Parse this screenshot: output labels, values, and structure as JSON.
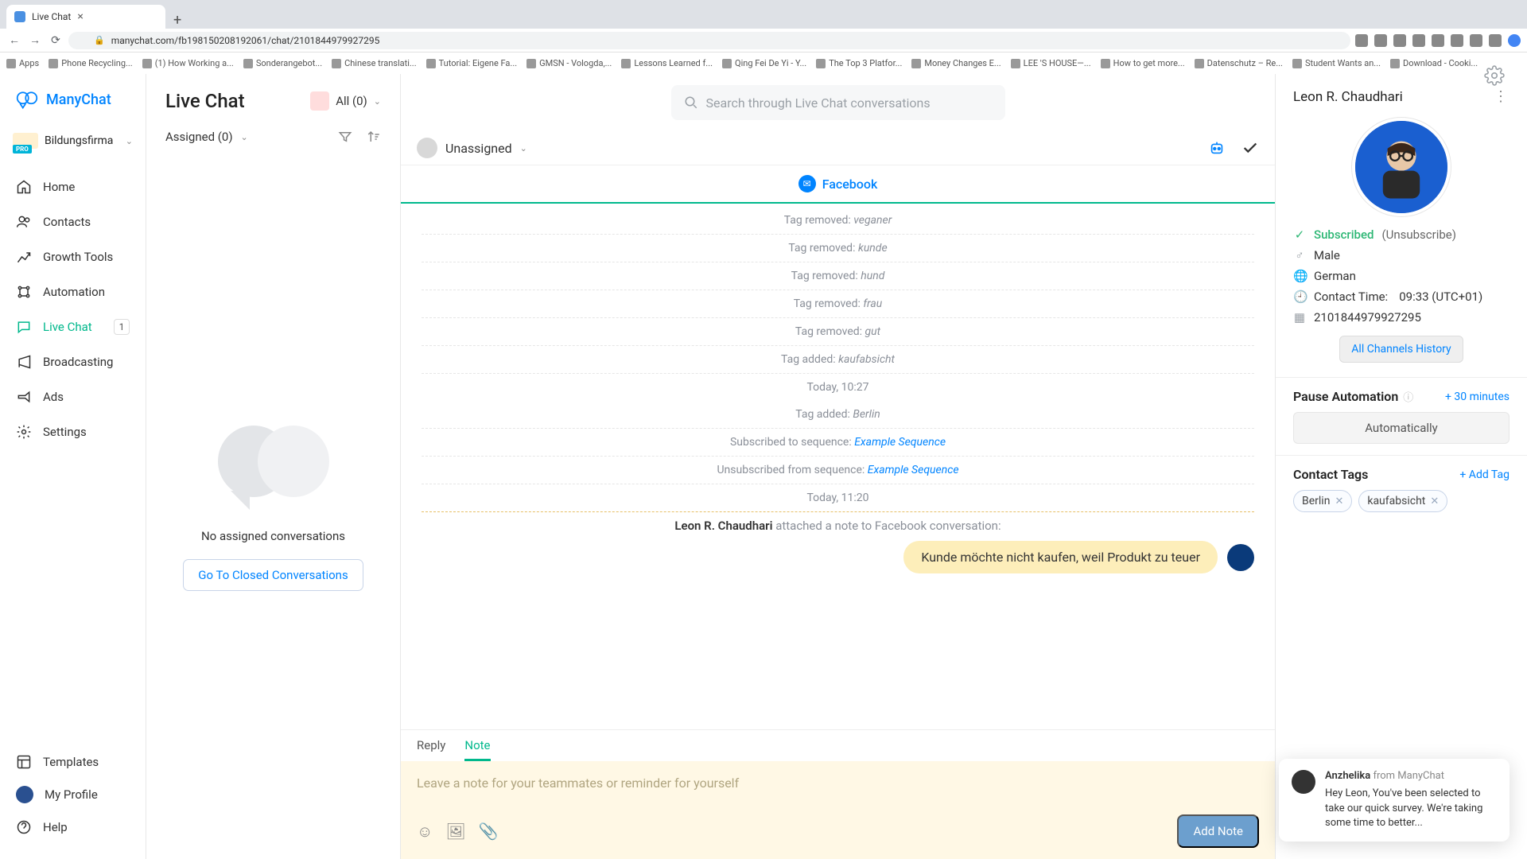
{
  "browser": {
    "tab_title": "Live Chat",
    "url": "manychat.com/fb198150208192061/chat/2101844979927295",
    "bookmarks": [
      "Apps",
      "Phone Recycling...",
      "(1) How Working a...",
      "Sonderangebot...",
      "Chinese translati...",
      "Tutorial: Eigene Fa...",
      "GMSN - Vologda,...",
      "Lessons Learned f...",
      "Qing Fei De Yi - Y...",
      "The Top 3 Platfor...",
      "Money Changes E...",
      "LEE 'S HOUSE—...",
      "How to get more...",
      "Datenschutz – Re...",
      "Student Wants an...",
      "Download - Cooki..."
    ]
  },
  "brand": {
    "name": "ManyChat"
  },
  "workspace": {
    "name": "Bildungsfirma",
    "badge": "PRO"
  },
  "nav": {
    "home": "Home",
    "contacts": "Contacts",
    "growth": "Growth Tools",
    "automation": "Automation",
    "livechat": "Live Chat",
    "livechat_badge": "1",
    "broadcasting": "Broadcasting",
    "ads": "Ads",
    "settings": "Settings",
    "templates": "Templates",
    "profile": "My Profile",
    "help": "Help"
  },
  "list": {
    "title": "Live Chat",
    "filter": "All (0)",
    "assigned": "Assigned (0)",
    "empty": "No assigned conversations",
    "closed_btn": "Go To Closed Conversations"
  },
  "search": {
    "placeholder": "Search through Live Chat conversations"
  },
  "chat": {
    "assignee": "Unassigned",
    "channel": "Facebook",
    "events": [
      {
        "prefix": "Tag removed: ",
        "em": "veganer"
      },
      {
        "prefix": "Tag removed: ",
        "em": "kunde"
      },
      {
        "prefix": "Tag removed: ",
        "em": "hund"
      },
      {
        "prefix": "Tag removed: ",
        "em": "frau"
      },
      {
        "prefix": "Tag removed: ",
        "em": "gut"
      },
      {
        "prefix": "Tag added: ",
        "em": "kaufabsicht"
      }
    ],
    "time1": "Today, 10:27",
    "events2": [
      {
        "prefix": "Tag added: ",
        "em": "Berlin"
      },
      {
        "prefix": "Subscribed to sequence: ",
        "link": "Example Sequence"
      },
      {
        "prefix": "Unsubscribed from sequence: ",
        "link": "Example Sequence"
      }
    ],
    "time2": "Today, 11:20",
    "note_author": "Leon R. Chaudhari",
    "note_action": " attached a note to Facebook conversation:",
    "note_text": "Kunde möchte nicht kaufen, weil Produkt zu teuer"
  },
  "compose": {
    "reply": "Reply",
    "note": "Note",
    "placeholder": "Leave a note for your teammates or reminder for yourself",
    "add_btn": "Add Note"
  },
  "info": {
    "name": "Leon R. Chaudhari",
    "subscribed": "Subscribed",
    "unsubscribe": "(Unsubscribe)",
    "gender": "Male",
    "language": "German",
    "contact_time_label": "Contact Time:",
    "contact_time_value": "09:33 (UTC+01)",
    "id": "2101844979927295",
    "history_btn": "All Channels History",
    "pause_title": "Pause Automation",
    "pause_add": "+ 30 minutes",
    "pause_auto": "Automatically",
    "tags_title": "Contact Tags",
    "tags_add": "+ Add Tag",
    "tags": [
      "Berlin",
      "kaufabsicht"
    ]
  },
  "toast": {
    "author": "Anzhelika",
    "from": " from ManyChat",
    "msg": "Hey Leon,  You've been selected to take our quick survey. We're taking some time to better..."
  }
}
